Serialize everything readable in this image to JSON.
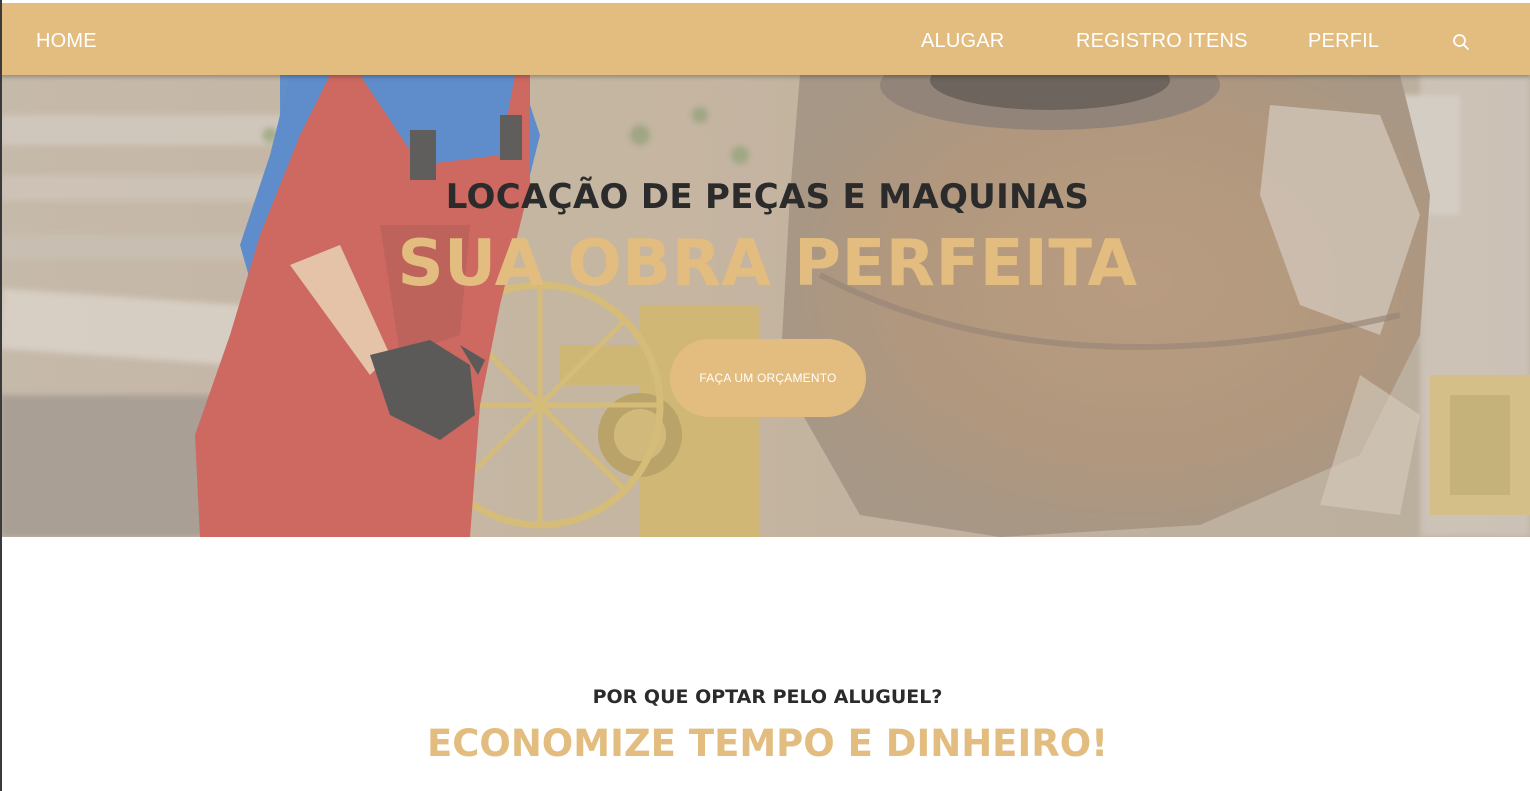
{
  "nav": {
    "home": "HOME",
    "alugar": "ALUGAR",
    "registro": "REGISTRO ITENS",
    "perfil": "PERFIL",
    "search_icon": "search-icon"
  },
  "hero": {
    "kicker": "LOCAÇÃO DE PEÇAS E MAQUINAS",
    "title": "SUA OBRA PERFEITA",
    "cta": "FAÇA UM ORÇAMENTO",
    "image": "worker-with-concrete-mixer-photo"
  },
  "why": {
    "kicker": "POR QUE OPTAR PELO ALUGUEL?",
    "title": "ECONOMIZE TEMPO E DINHEIRO!"
  },
  "colors": {
    "accent": "#e2bd7f",
    "text_dark": "#2b2b2b",
    "white": "#ffffff"
  }
}
